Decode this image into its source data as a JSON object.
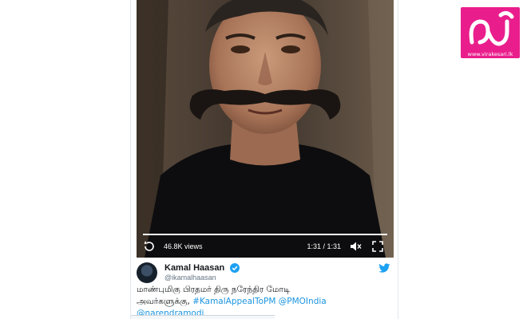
{
  "video": {
    "views": "46.8K views",
    "time": "1:31 / 1:31",
    "progress": 1.0
  },
  "tweet": {
    "name": "Kamal Haasan",
    "handle": "@ikamalhaasan",
    "line1": "மாண்புமிகு பிரதமர் திரு  நரேந்திர மோடி",
    "line2_text": "அவர்களுக்கு, ",
    "hashtag": "#KamalAppealToPM",
    "mention1": "@PMOIndia",
    "mention2": "@narendramodi",
    "verified": true
  },
  "logo": {
    "glyph": "வீ",
    "url": "www.virakesari.lk",
    "color": "#e91e8c"
  },
  "colors": {
    "link": "#1b95e0",
    "verified": "#1da1f2"
  },
  "icons": [
    "replay-icon",
    "volume-icon",
    "fullscreen-icon",
    "verified-icon",
    "twitter-bird-icon"
  ]
}
